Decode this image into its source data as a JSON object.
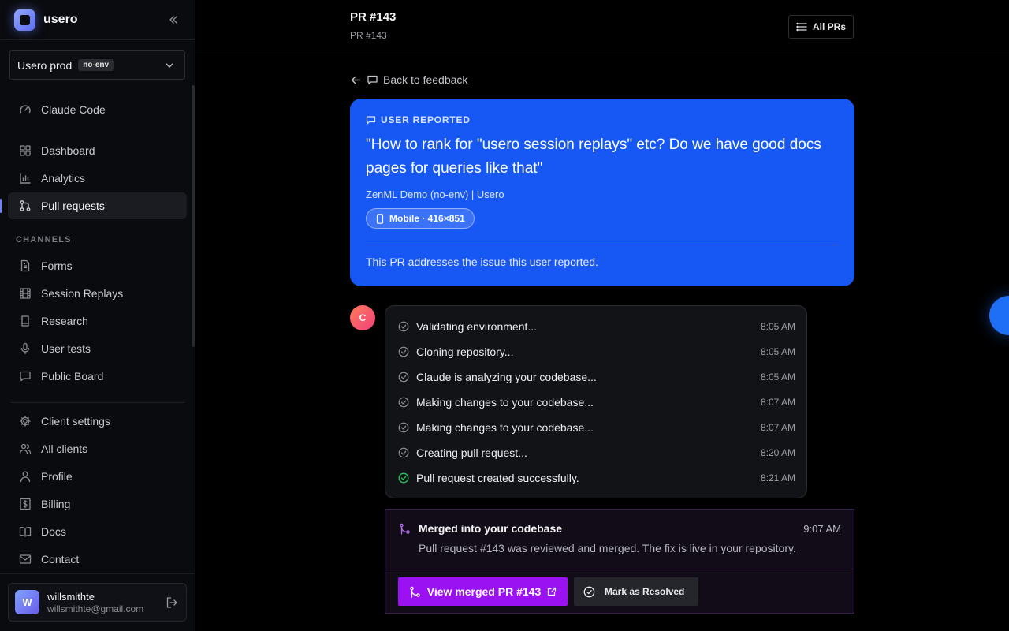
{
  "brand": {
    "name": "usero"
  },
  "environment": {
    "name": "Usero prod",
    "badge": "no-env"
  },
  "nav": {
    "top": [
      {
        "label": "Claude Code",
        "icon": "gauge-icon"
      }
    ],
    "main": [
      {
        "label": "Dashboard",
        "icon": "grid-icon"
      },
      {
        "label": "Analytics",
        "icon": "bar-chart-icon"
      },
      {
        "label": "Pull requests",
        "icon": "git-pull-request-icon",
        "active": true
      }
    ],
    "channels_label": "CHANNELS",
    "channels": [
      {
        "label": "Forms",
        "icon": "document-icon"
      },
      {
        "label": "Session Replays",
        "icon": "film-icon"
      },
      {
        "label": "Research",
        "icon": "clipboard-icon"
      },
      {
        "label": "User tests",
        "icon": "microphone-icon"
      },
      {
        "label": "Public Board",
        "icon": "chat-icon"
      }
    ],
    "settings": [
      {
        "label": "Client settings",
        "icon": "gear-icon"
      },
      {
        "label": "All clients",
        "icon": "users-icon"
      },
      {
        "label": "Profile",
        "icon": "user-icon"
      },
      {
        "label": "Billing",
        "icon": "dollar-icon"
      },
      {
        "label": "Docs",
        "icon": "book-icon"
      },
      {
        "label": "Contact",
        "icon": "mail-icon"
      }
    ]
  },
  "user": {
    "initial": "W",
    "name": "willsmithte",
    "email": "willsmithte@gmail.com"
  },
  "header": {
    "title": "PR #143",
    "subtitle": "PR #143",
    "all_prs_label": "All PRs"
  },
  "back_link": "Back to feedback",
  "report": {
    "tag": "USER REPORTED",
    "quote": "\"How to rank for \"usero session replays\" etc? Do we have good docs pages for queries like that\"",
    "site": "ZenML Demo (no-env) | Usero",
    "device": "Mobile · 416×851",
    "note": "This PR addresses the issue this user reported."
  },
  "bot": {
    "initial": "C"
  },
  "steps": [
    {
      "text": "Validating environment...",
      "time": "8:05 AM",
      "status": "done"
    },
    {
      "text": "Cloning repository...",
      "time": "8:05 AM",
      "status": "done"
    },
    {
      "text": "Claude is analyzing your codebase...",
      "time": "8:05 AM",
      "status": "done"
    },
    {
      "text": "Making changes to your codebase...",
      "time": "8:07 AM",
      "status": "done"
    },
    {
      "text": "Making changes to your codebase...",
      "time": "8:07 AM",
      "status": "done"
    },
    {
      "text": "Creating pull request...",
      "time": "8:20 AM",
      "status": "done"
    },
    {
      "text": "Pull request created successfully.",
      "time": "8:21 AM",
      "status": "success"
    }
  ],
  "merged": {
    "title": "Merged into your codebase",
    "time": "9:07 AM",
    "description": "Pull request #143 was reviewed and merged. The fix is live in your repository.",
    "view_label": "View merged PR #143",
    "resolve_label": "Mark as Resolved"
  },
  "colors": {
    "accent": "#1758f5",
    "merged_purple": "#9b12f2",
    "success_green": "#22c55e",
    "active_indicator": "#6e83ff"
  }
}
